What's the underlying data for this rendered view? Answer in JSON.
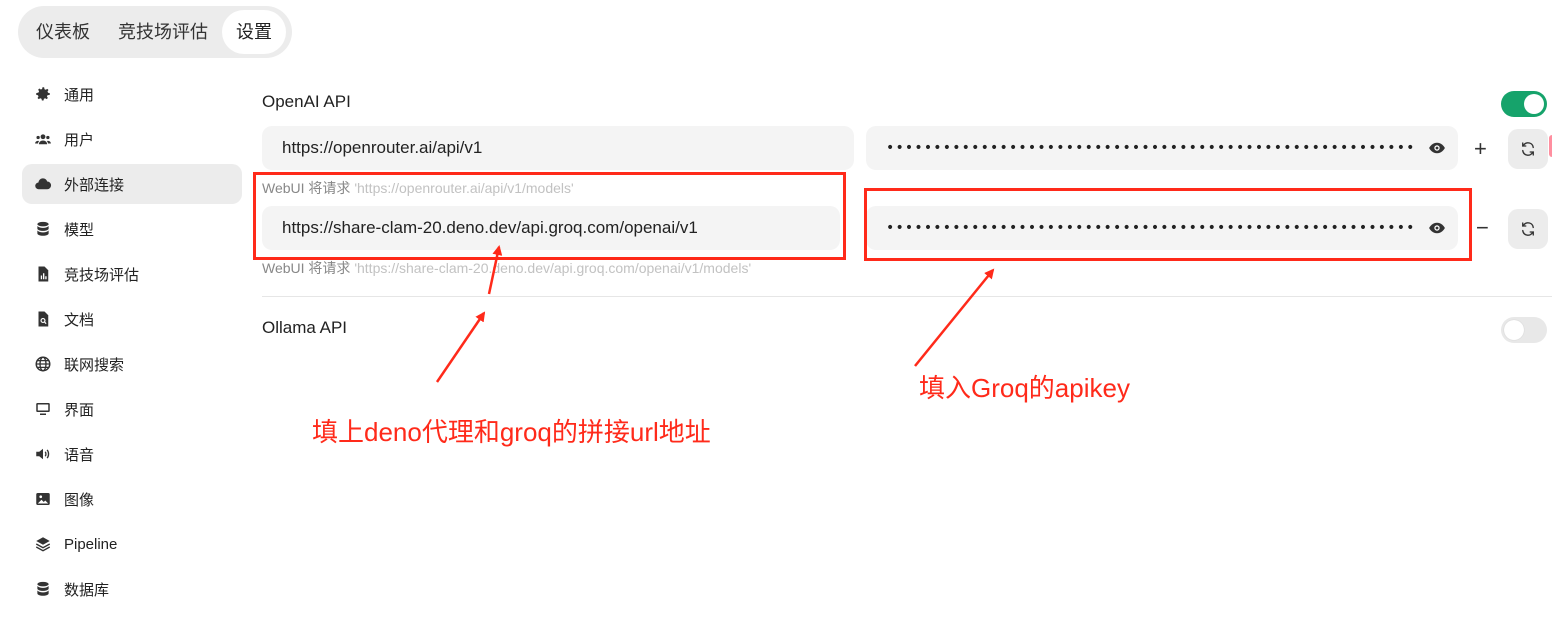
{
  "tabs": [
    {
      "label": "仪表板",
      "active": false
    },
    {
      "label": "竞技场评估",
      "active": false
    },
    {
      "label": "设置",
      "active": true
    }
  ],
  "sidebar": {
    "items": [
      {
        "label": "通用",
        "icon": "gear-icon"
      },
      {
        "label": "用户",
        "icon": "users-icon"
      },
      {
        "label": "外部连接",
        "icon": "cloud-icon",
        "active": true
      },
      {
        "label": "模型",
        "icon": "database-icon"
      },
      {
        "label": "竞技场评估",
        "icon": "chart-document-icon"
      },
      {
        "label": "文档",
        "icon": "document-search-icon"
      },
      {
        "label": "联网搜索",
        "icon": "globe-icon"
      },
      {
        "label": "界面",
        "icon": "monitor-icon"
      },
      {
        "label": "语音",
        "icon": "speaker-icon"
      },
      {
        "label": "图像",
        "icon": "image-icon"
      },
      {
        "label": "Pipeline",
        "icon": "layers-icon"
      },
      {
        "label": "数据库",
        "icon": "database-icon"
      }
    ]
  },
  "openai": {
    "title": "OpenAI API",
    "enabled": true,
    "connections": [
      {
        "url": "https://openrouter.ai/api/v1",
        "key_masked": "••••••••••••••••••••••••••••••••••••••••••••••••••••••••••••••••",
        "hint_prefix": "WebUI 将请求",
        "hint_url": "'https://openrouter.ai/api/v1/models'",
        "action": "+"
      },
      {
        "url": "https://share-clam-20.deno.dev/api.groq.com/openai/v1",
        "key_masked": "••••••••••••••••••••••••••••••••••••••••••••••••••••••••••••••••",
        "hint_prefix": "WebUI 将请求",
        "hint_url": "'https://share-clam-20.deno.dev/api.groq.com/openai/v1/models'",
        "action": "−"
      }
    ]
  },
  "ollama": {
    "title": "Ollama API",
    "enabled": false
  },
  "annotations": {
    "left": "填上deno代理和groq的拼接url地址",
    "right": "填入Groq的apikey",
    "color": "#ff2a1a"
  },
  "colors": {
    "toggle_on": "#16a36b",
    "toggle_off": "#e8e8e8"
  }
}
